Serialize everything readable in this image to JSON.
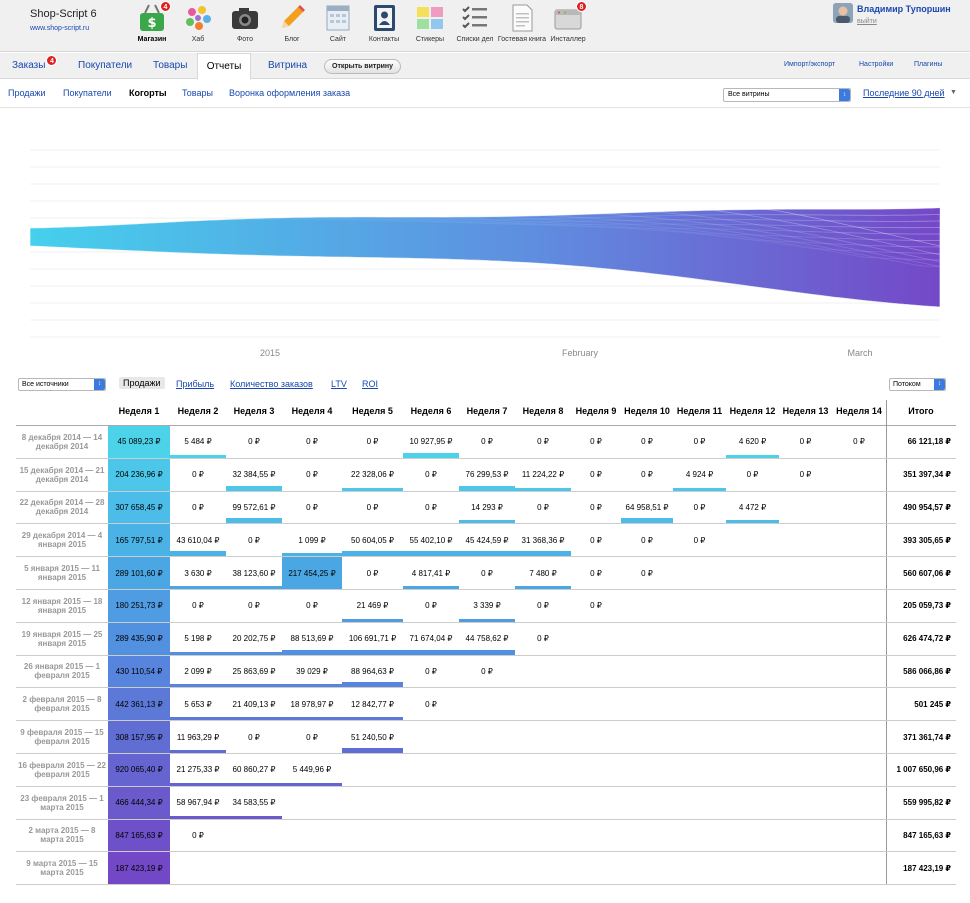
{
  "brand": {
    "name": "Shop-Script 6",
    "url": "www.shop-script.ru"
  },
  "apps": [
    {
      "key": "shop",
      "label": "Магазин",
      "icon": "shop-basket-icon",
      "badge": "4",
      "active": true
    },
    {
      "key": "hub",
      "label": "Хаб",
      "icon": "hub-dots-icon"
    },
    {
      "key": "photos",
      "label": "Фото",
      "icon": "camera-icon"
    },
    {
      "key": "blog",
      "label": "Блог",
      "icon": "pencil-icon"
    },
    {
      "key": "site",
      "label": "Сайт",
      "icon": "site-calendar-icon"
    },
    {
      "key": "contacts",
      "label": "Контакты",
      "icon": "contacts-book-icon"
    },
    {
      "key": "stickies",
      "label": "Стикеры",
      "icon": "stickies-icon"
    },
    {
      "key": "checklists",
      "label": "Списки дел",
      "icon": "checklist-icon"
    },
    {
      "key": "guestbook",
      "label": "Гостевая книга",
      "icon": "guestbook-icon"
    },
    {
      "key": "installer",
      "label": "Инсталлер",
      "icon": "installer-icon",
      "badge": "8"
    }
  ],
  "user": {
    "name": "Владимир Тупоршин",
    "logout": "выйти"
  },
  "tabs": [
    {
      "label": "Заказы",
      "badge": "4"
    },
    {
      "label": "Покупатели"
    },
    {
      "label": "Товары"
    },
    {
      "label": "Отчеты",
      "active": true
    },
    {
      "label": "Витрина"
    }
  ],
  "open_store_label": "Открыть витрину",
  "right_links": [
    "Импорт/экспорт",
    "Настройки",
    "Плагины"
  ],
  "subnav": [
    {
      "label": "Продажи"
    },
    {
      "label": "Покупатели"
    },
    {
      "label": "Когорты",
      "active": true
    },
    {
      "label": "Товары"
    },
    {
      "label": "Воронка оформления заказа"
    }
  ],
  "store_select": "Все витрины",
  "period": "Последние 90 дней",
  "chart_data": {
    "type": "area",
    "style": "streamgraph",
    "x_ticks": [
      "2015",
      "February",
      "March"
    ],
    "colors": {
      "start": "#45d0ec",
      "mid": "#5f8ee0",
      "end": "#7448c8"
    },
    "series_count": 14
  },
  "controls": {
    "source": "Все источники",
    "metrics": [
      {
        "label": "Продажи",
        "active": true
      },
      {
        "label": "Прибыль"
      },
      {
        "label": "Количество заказов"
      },
      {
        "label": "LTV"
      },
      {
        "label": "ROI"
      }
    ],
    "mode": "Потоком"
  },
  "table": {
    "headers": [
      "Неделя 1",
      "Неделя 2",
      "Неделя 3",
      "Неделя 4",
      "Неделя 5",
      "Неделя 6",
      "Неделя 7",
      "Неделя 8",
      "Неделя 9",
      "Неделя 10",
      "Неделя 11",
      "Неделя 12",
      "Неделя 13",
      "Неделя 14"
    ],
    "total_header": "Итого",
    "rows": [
      {
        "label": "8 декабря 2014 — 14 декабря 2014",
        "cells": [
          "45 089,23 ₽",
          "5 484 ₽",
          "0 ₽",
          "0 ₽",
          "0 ₽",
          "10 927,95 ₽",
          "0 ₽",
          "0 ₽",
          "0 ₽",
          "0 ₽",
          "0 ₽",
          "4 620 ₽",
          "0 ₽",
          "0 ₽"
        ],
        "total": "66 121,18 ₽",
        "color": "#4cd3ea"
      },
      {
        "label": "15 декабря 2014 — 21 декабря 2014",
        "cells": [
          "204 236,96 ₽",
          "0 ₽",
          "32 384,55 ₽",
          "0 ₽",
          "22 328,06 ₽",
          "0 ₽",
          "76 299,53 ₽",
          "11 224,22 ₽",
          "0 ₽",
          "0 ₽",
          "4 924 ₽",
          "0 ₽",
          "0 ₽"
        ],
        "total": "351 397,34 ₽",
        "color": "#4cc7ea"
      },
      {
        "label": "22 декабря 2014 — 28 декабря 2014",
        "cells": [
          "307 658,45 ₽",
          "0 ₽",
          "99 572,61 ₽",
          "0 ₽",
          "0 ₽",
          "0 ₽",
          "14 293 ₽",
          "0 ₽",
          "0 ₽",
          "64 958,51 ₽",
          "0 ₽",
          "4 472 ₽"
        ],
        "total": "490 954,57 ₽",
        "color": "#4bbde8"
      },
      {
        "label": "29 декабря 2014 — 4 января 2015",
        "cells": [
          "165 797,51 ₽",
          "43 610,04 ₽",
          "0 ₽",
          "1 099 ₽",
          "50 604,05 ₽",
          "55 402,10 ₽",
          "45 424,59 ₽",
          "31 368,36 ₽",
          "0 ₽",
          "0 ₽",
          "0 ₽"
        ],
        "total": "393 305,65 ₽",
        "color": "#4bb2e6"
      },
      {
        "label": "5 января 2015 — 11 января 2015",
        "cells": [
          "289 101,60 ₽",
          "3 630 ₽",
          "38 123,60 ₽",
          "217 454,25 ₽",
          "0 ₽",
          "4 817,41 ₽",
          "0 ₽",
          "7 480 ₽",
          "0 ₽",
          "0 ₽"
        ],
        "total": "560 607,06 ₽",
        "color": "#4ba7e4"
      },
      {
        "label": "12 января 2015 — 18 января 2015",
        "cells": [
          "180 251,73 ₽",
          "0 ₽",
          "0 ₽",
          "0 ₽",
          "21 469 ₽",
          "0 ₽",
          "3 339 ₽",
          "0 ₽",
          "0 ₽"
        ],
        "total": "205 059,73 ₽",
        "color": "#4f9ce2"
      },
      {
        "label": "19 января 2015 — 25 января 2015",
        "cells": [
          "289 435,90 ₽",
          "5 198 ₽",
          "20 202,75 ₽",
          "88 513,69 ₽",
          "106 691,71 ₽",
          "71 674,04 ₽",
          "44 758,62 ₽",
          "0 ₽"
        ],
        "total": "626 474,72 ₽",
        "color": "#5290e0"
      },
      {
        "label": "26 января 2015 — 1 февраля 2015",
        "cells": [
          "430 110,54 ₽",
          "2 099 ₽",
          "25 863,69 ₽",
          "39 029 ₽",
          "88 964,63 ₽",
          "0 ₽",
          "0 ₽"
        ],
        "total": "586 066,86 ₽",
        "color": "#5784dc"
      },
      {
        "label": "2 февраля 2015 — 8 февраля 2015",
        "cells": [
          "442 361,13 ₽",
          "5 653 ₽",
          "21 409,13 ₽",
          "18 978,97 ₽",
          "12 842,77 ₽",
          "0 ₽"
        ],
        "total": "501 245 ₽",
        "color": "#5c79d8"
      },
      {
        "label": "9 февраля 2015 — 15 февраля 2015",
        "cells": [
          "308 157,95 ₽",
          "11 963,29 ₽",
          "0 ₽",
          "0 ₽",
          "51 240,50 ₽"
        ],
        "total": "371 361,74 ₽",
        "color": "#606ed4"
      },
      {
        "label": "16 февраля 2015 — 22 февраля 2015",
        "cells": [
          "920 065,40 ₽",
          "21 275,33 ₽",
          "60 860,27 ₽",
          "5 449,96 ₽"
        ],
        "total": "1 007 650,96 ₽",
        "color": "#6564d0"
      },
      {
        "label": "23 февраля 2015 — 1 марта 2015",
        "cells": [
          "466 444,34 ₽",
          "58 967,94 ₽",
          "34 583,55 ₽"
        ],
        "total": "559 995,82 ₽",
        "color": "#6a5acc"
      },
      {
        "label": "2 марта 2015 — 8 марта 2015",
        "cells": [
          "847 165,63 ₽",
          "0 ₽"
        ],
        "total": "847 165,63 ₽",
        "color": "#6e50c8"
      },
      {
        "label": "9 марта 2015 — 15 марта 2015",
        "cells": [
          "187 423,19 ₽"
        ],
        "total": "187 423,19 ₽",
        "color": "#7348c6"
      }
    ]
  }
}
